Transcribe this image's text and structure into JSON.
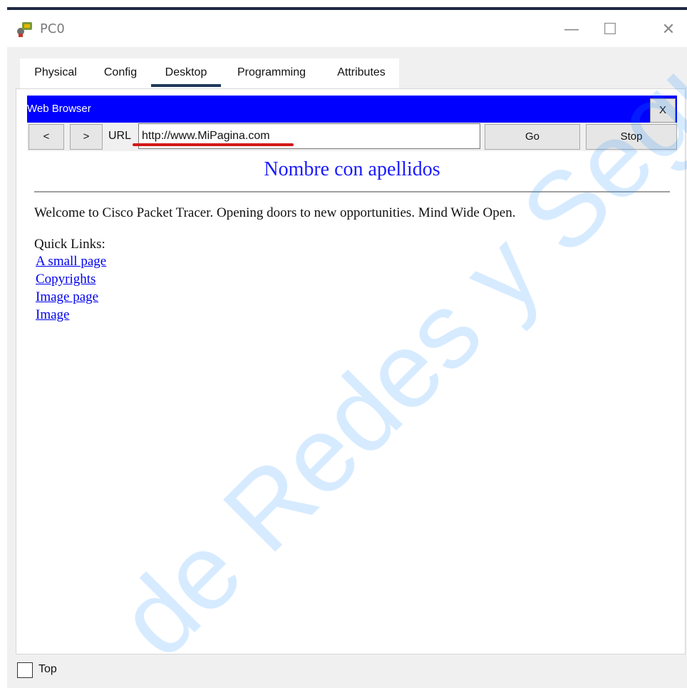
{
  "window": {
    "title": "PC0",
    "app_icon": "packet-tracer-pc-icon",
    "controls": {
      "minimize": "—",
      "maximize": "☐",
      "close": "✕"
    }
  },
  "tabs": [
    {
      "label": "Physical"
    },
    {
      "label": "Config"
    },
    {
      "label": "Desktop",
      "active": true
    },
    {
      "label": "Programming"
    },
    {
      "label": "Attributes"
    }
  ],
  "web_browser": {
    "title": "Web Browser",
    "close_label": "X",
    "back_label": "<",
    "forward_label": ">",
    "url_label": "URL",
    "url_value": "http://www.MiPagina.com",
    "go_label": "Go",
    "stop_label": "Stop",
    "title_bar_color": "#0000ff"
  },
  "page": {
    "heading": "Nombre con apellidos",
    "heading_color": "#1a1aff",
    "welcome": "Welcome to Cisco Packet Tracer. Opening doors to new opportunities. Mind Wide Open.",
    "quick_links_label": "Quick Links:",
    "links": [
      "A small page",
      "Copyrights",
      "Image page",
      "Image"
    ]
  },
  "footer": {
    "top_label": "Top",
    "top_checked": false
  },
  "watermark": {
    "text": "de Redes y Seguridad"
  }
}
